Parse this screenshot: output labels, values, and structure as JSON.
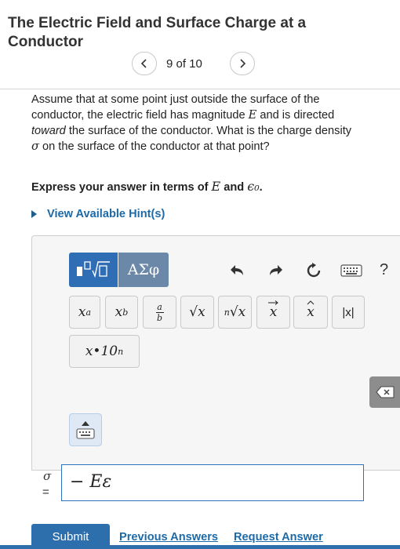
{
  "header": {
    "title": "The Electric Field and Surface Charge at a Conductor",
    "pager_text": "9 of 10"
  },
  "question": {
    "part1": "Assume that at some point just outside the surface of the conductor, the electric field has magnitude ",
    "symbol_E": "E",
    "part2": " and is directed ",
    "emphasis": "toward",
    "part3": " the surface of the conductor. What is the charge density ",
    "symbol_sigma": "σ",
    "part4": " on the surface of the conductor at that point?"
  },
  "instruction": {
    "prefix": "Express your answer in terms of ",
    "symbol_E": "E",
    "and": " and ",
    "symbol_eps": "ϵ₀",
    "suffix": "."
  },
  "hint": {
    "label": "View Available Hint(s)"
  },
  "toolbar": {
    "greek_label": "ΑΣφ",
    "help_label": "?",
    "buttons": {
      "power_base": "x",
      "power_exp": "a",
      "sub_base": "x",
      "sub_idx": "b",
      "frac_num": "a",
      "frac_den": "b",
      "sqrt": "√x",
      "nroot_idx": "n",
      "nroot": "√x",
      "vector": "x",
      "unit": "x",
      "abs": "|x|",
      "sci": "x•10",
      "sci_exp": "n"
    }
  },
  "answer": {
    "variable": "σ",
    "equals": "=",
    "value": "− Eε"
  },
  "actions": {
    "submit": "Submit",
    "previous_answers": "Previous Answers",
    "request_answer": "Request Answer"
  },
  "colors": {
    "primary": "#2c6fac",
    "link": "#1c6aa8",
    "templates_button": "#2f6eb5",
    "greek_button": "#6c88a9"
  }
}
